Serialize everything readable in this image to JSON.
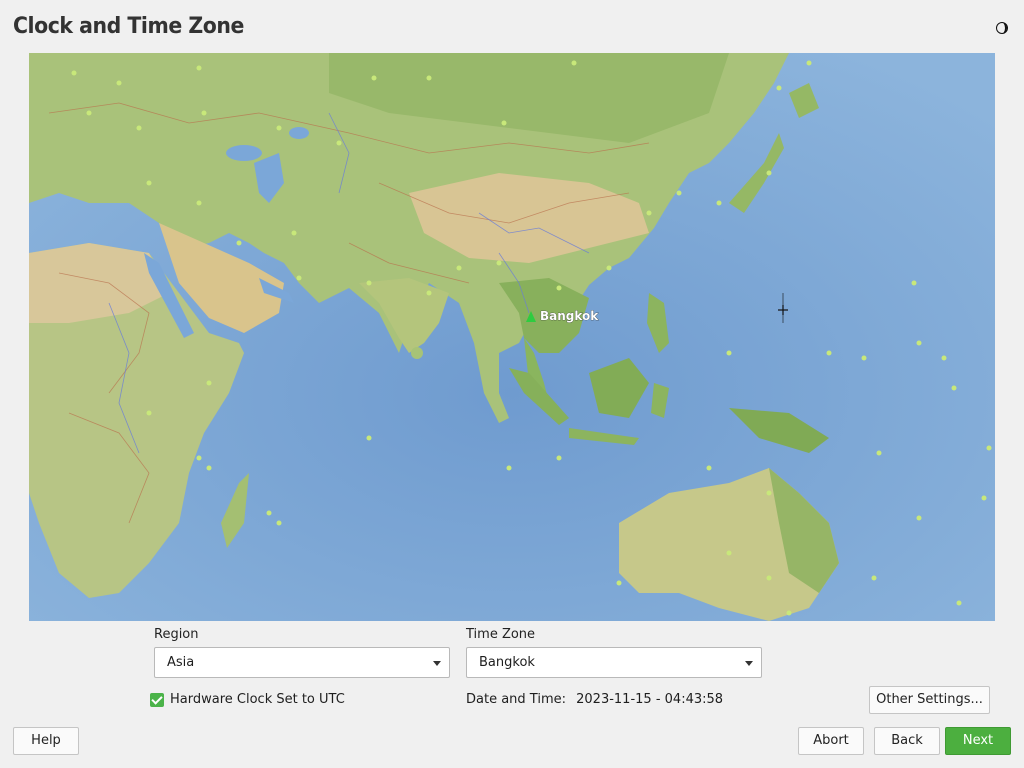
{
  "window": {
    "title": "Clock and Time Zone"
  },
  "map": {
    "selected_city": "Bangkok",
    "colors": {
      "ocean": "#7fa9d6",
      "land": "#a9c27a",
      "desert": "#d8c594",
      "marker": "#2ecc40",
      "city_dots": "#c8e87a"
    }
  },
  "region": {
    "label": "Region",
    "value": "Asia"
  },
  "timezone": {
    "label": "Time Zone",
    "value": "Bangkok"
  },
  "hardware_clock": {
    "label": "Hardware Clock Set to UTC",
    "checked": true
  },
  "datetime": {
    "label": "Date and Time:",
    "value": "2023-11-15 - 04:43:58"
  },
  "buttons": {
    "other_settings": "Other Settings...",
    "help": "Help",
    "abort": "Abort",
    "back": "Back",
    "next": "Next"
  },
  "icons": {
    "theme_toggle": "half-moon-icon",
    "checkbox": "check-icon",
    "dropdown": "chevron-down-icon",
    "map_marker": "triangle-marker-icon",
    "cursor": "crosshair-icon"
  }
}
